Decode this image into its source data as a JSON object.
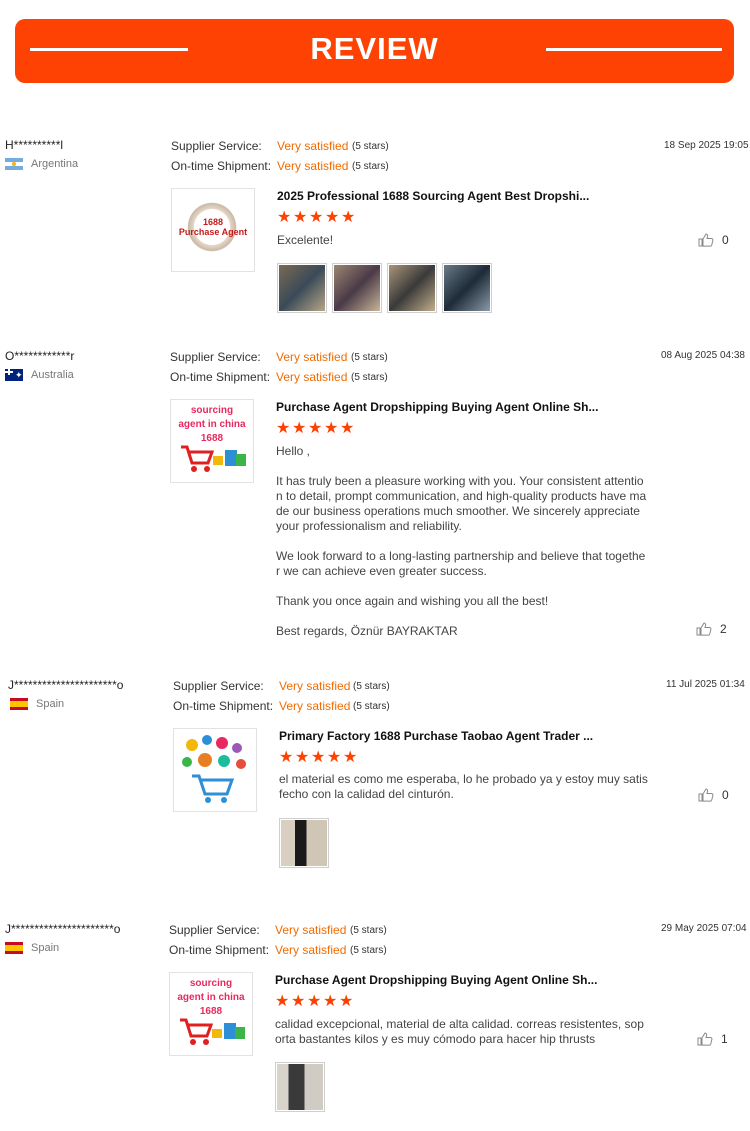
{
  "banner": {
    "title": "REVIEW",
    "color": "#fe4203"
  },
  "labels": {
    "supplier": "Supplier Service:",
    "shipment": "On-time Shipment:"
  },
  "reviews": [
    {
      "user": "H**********l",
      "country": "Argentina",
      "flag": "argentina-flag",
      "supplier_rating": "Very satisfied",
      "supplier_stars": "(5 stars)",
      "shipment_rating": "Very satisfied",
      "shipment_stars": "(5 stars)",
      "date": "18 Sep 2025 19:05",
      "product_title": "2025 Professional 1688 Sourcing Agent Best Dropshi...",
      "product_thumb_text": "1688\nPurchase Agent",
      "stars": 5,
      "text": "Excelente!",
      "likes": "0",
      "photos": 4
    },
    {
      "user": "O************r",
      "country": "Australia",
      "flag": "australia-flag",
      "supplier_rating": "Very satisfied",
      "supplier_stars": "(5 stars)",
      "shipment_rating": "Very satisfied",
      "shipment_stars": "(5 stars)",
      "date": "08 Aug 2025 04:38",
      "product_title": "Purchase Agent Dropshipping Buying Agent Online Sh...",
      "product_thumb_text": "sourcing\nagent in china\n1688",
      "stars": 5,
      "text": "Hello ,\n\nIt has truly been a pleasure working with you. Your consistent attention to detail, prompt communication, and high-quality products have made our business operations much smoother. We sincerely appreciate your professionalism and reliability.\n\nWe look forward to a long-lasting partnership and believe that together we can achieve even greater success.\n\nThank you once again and wishing you all the best!\n\nBest regards, Öznür BAYRAKTAR",
      "likes": "2",
      "photos": 0
    },
    {
      "user": "J**********************o",
      "country": "Spain",
      "flag": "spain-flag",
      "supplier_rating": "Very satisfied",
      "supplier_stars": "(5 stars)",
      "shipment_rating": "Very satisfied",
      "shipment_stars": "(5 stars)",
      "date": "11 Jul 2025 01:34",
      "product_title": "Primary Factory 1688 Purchase Taobao Agent Trader ...",
      "stars": 5,
      "text": "el material es como me esperaba, lo he probado ya y estoy muy satisfecho con la calidad del cinturón.",
      "likes": "0",
      "photos": 1
    },
    {
      "user": "J**********************o",
      "country": "Spain",
      "flag": "spain-flag",
      "supplier_rating": "Very satisfied",
      "supplier_stars": "(5 stars)",
      "shipment_rating": "Very satisfied",
      "shipment_stars": "(5 stars)",
      "date": "29 May 2025 07:04",
      "product_title": "Purchase Agent Dropshipping Buying Agent Online Sh...",
      "product_thumb_text": "sourcing\nagent in china\n1688",
      "stars": 5,
      "text": "calidad excepcional, material de alta calidad. correas resistentes, soporta bastantes kilos y es muy cómodo para hacer hip thrusts",
      "likes": "1",
      "photos": 1
    }
  ]
}
